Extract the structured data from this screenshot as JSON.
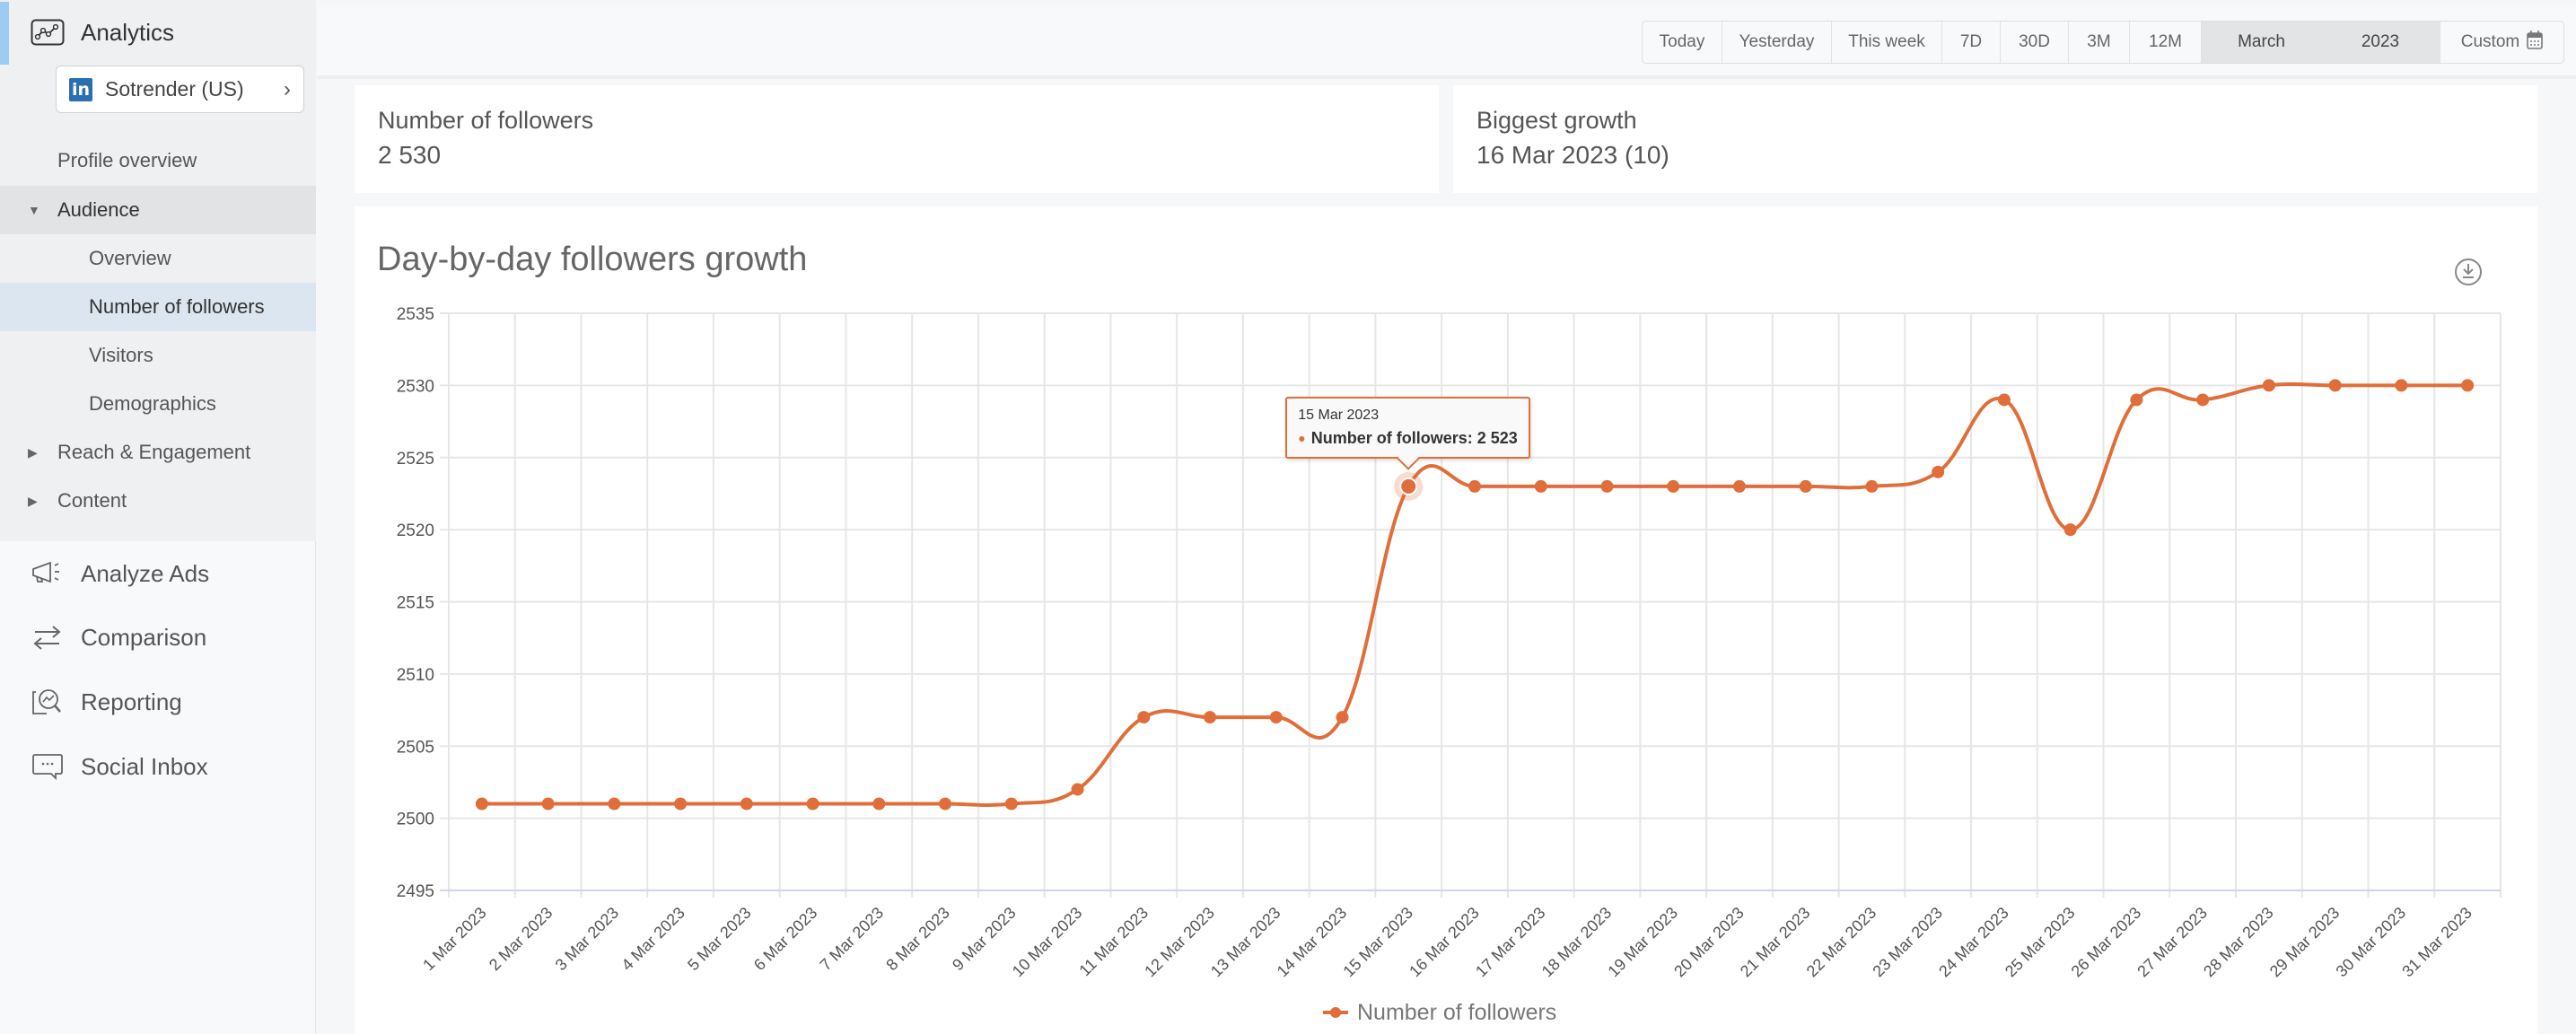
{
  "sidebar": {
    "analytics_label": "Analytics",
    "profile": {
      "network_icon": "linkedin-icon",
      "name": "Sotrender (US)"
    },
    "items": [
      {
        "label": "Profile overview"
      },
      {
        "label": "Audience",
        "expanded": true
      },
      {
        "label": "Overview"
      },
      {
        "label": "Number of followers",
        "active": true
      },
      {
        "label": "Visitors"
      },
      {
        "label": "Demographics"
      },
      {
        "label": "Reach & Engagement"
      },
      {
        "label": "Content"
      }
    ],
    "main_nav": [
      {
        "label": "Analyze Ads",
        "icon": "megaphone-icon"
      },
      {
        "label": "Comparison",
        "icon": "arrows-exchange-icon"
      },
      {
        "label": "Reporting",
        "icon": "report-search-icon"
      },
      {
        "label": "Social Inbox",
        "icon": "chat-bubble-icon"
      }
    ]
  },
  "date_range": {
    "buttons": [
      "Today",
      "Yesterday",
      "This week",
      "7D",
      "30D",
      "3M",
      "12M"
    ],
    "selected_month": "March",
    "selected_year": "2023",
    "custom_label": "Custom"
  },
  "stats": {
    "followers": {
      "label": "Number of followers",
      "value": "2 530"
    },
    "growth": {
      "label": "Biggest growth",
      "value": "16 Mar 2023 (10)"
    }
  },
  "chart_title": "Day-by-day followers growth",
  "tooltip": {
    "date": "15 Mar 2023",
    "text": "Number of followers: 2 523"
  },
  "colors": {
    "series": "#e06e3a",
    "accent": "#9ecbf3"
  },
  "chart_data": {
    "type": "line",
    "title": "Day-by-day followers growth",
    "xlabel": "",
    "ylabel": "",
    "ylim": [
      2495,
      2535
    ],
    "yticks": [
      2495,
      2500,
      2505,
      2510,
      2515,
      2520,
      2525,
      2530,
      2535
    ],
    "grid": true,
    "legend": "bottom-center",
    "categories": [
      "1 Mar 2023",
      "2 Mar 2023",
      "3 Mar 2023",
      "4 Mar 2023",
      "5 Mar 2023",
      "6 Mar 2023",
      "7 Mar 2023",
      "8 Mar 2023",
      "9 Mar 2023",
      "10 Mar 2023",
      "11 Mar 2023",
      "12 Mar 2023",
      "13 Mar 2023",
      "14 Mar 2023",
      "15 Mar 2023",
      "16 Mar 2023",
      "17 Mar 2023",
      "18 Mar 2023",
      "19 Mar 2023",
      "20 Mar 2023",
      "21 Mar 2023",
      "22 Mar 2023",
      "23 Mar 2023",
      "24 Mar 2023",
      "25 Mar 2023",
      "26 Mar 2023",
      "27 Mar 2023",
      "28 Mar 2023",
      "29 Mar 2023",
      "30 Mar 2023",
      "31 Mar 2023"
    ],
    "series": [
      {
        "name": "Number of followers",
        "values": [
          2501,
          2501,
          2501,
          2501,
          2501,
          2501,
          2501,
          2501,
          2501,
          2502,
          2507,
          2507,
          2507,
          2507,
          2523,
          2523,
          2523,
          2523,
          2523,
          2523,
          2523,
          2523,
          2524,
          2529,
          2520,
          2529,
          2529,
          2530,
          2530,
          2530,
          2530
        ]
      }
    ],
    "highlighted_index": 14
  }
}
